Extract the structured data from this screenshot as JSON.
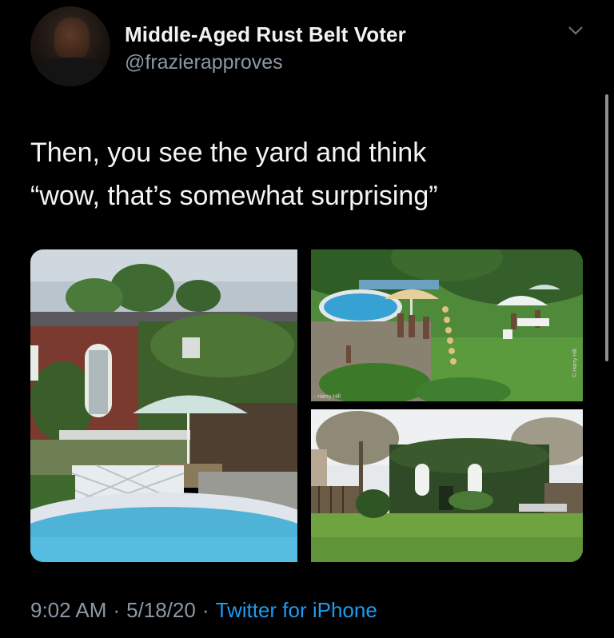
{
  "author": {
    "display_name": "Middle-Aged Rust Belt Voter",
    "handle": "@frazierapproves",
    "avatar_icon": "profile-photo"
  },
  "tweet": {
    "text": "Then, you see the yard and think\n“wow, that’s somewhat surprising”"
  },
  "media": {
    "photo_count": 3,
    "watermarks": [
      "© Harry Hill"
    ]
  },
  "meta": {
    "time": "9:02 AM",
    "date": "5/18/20",
    "separator": "·",
    "source": "Twitter for iPhone"
  },
  "colors": {
    "background": "#000000",
    "primary_text": "#e7e9ea",
    "secondary_text": "#8b98a5",
    "link": "#1d9bf0"
  },
  "icons": {
    "more_menu": "chevron-down-icon"
  }
}
